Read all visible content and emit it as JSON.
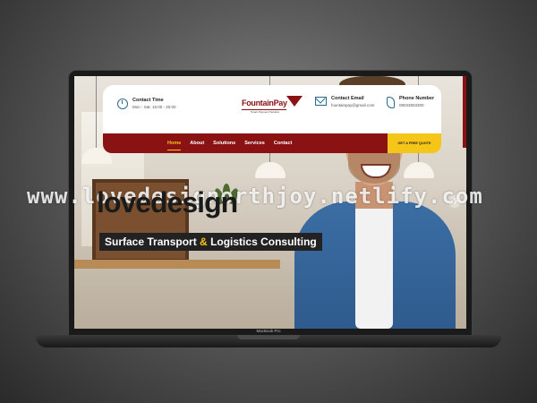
{
  "header": {
    "contact_time_label": "Contact Time",
    "contact_time_value": "Mon - Sat: 15:00 - 20:00",
    "logo_text": "FountainPay",
    "logo_tagline": "Smart Payment Solution",
    "contact_email_label": "Contact Email",
    "contact_email_value": "fountainpay@gmail.com",
    "phone_label": "Phone Number",
    "phone_value": "08033603300"
  },
  "nav": {
    "items": [
      {
        "label": "Home",
        "active": true
      },
      {
        "label": "About"
      },
      {
        "label": "Solutions"
      },
      {
        "label": "Services"
      },
      {
        "label": "Contact"
      }
    ],
    "quote_button": "GET A FREE QUOTE"
  },
  "hero": {
    "title_part1": "Surface Transport",
    "title_amp": "&",
    "title_part2": "Logistics Consulting"
  },
  "device": {
    "model_label": "MacBook Pro"
  },
  "watermark": {
    "text": "www.lovedesignorthjoy.netlify.com",
    "overlay_word": "lovedesign"
  },
  "colors": {
    "brand_red": "#8b1212",
    "accent_yellow": "#f5c518",
    "icon_blue": "#2a6a8a"
  }
}
